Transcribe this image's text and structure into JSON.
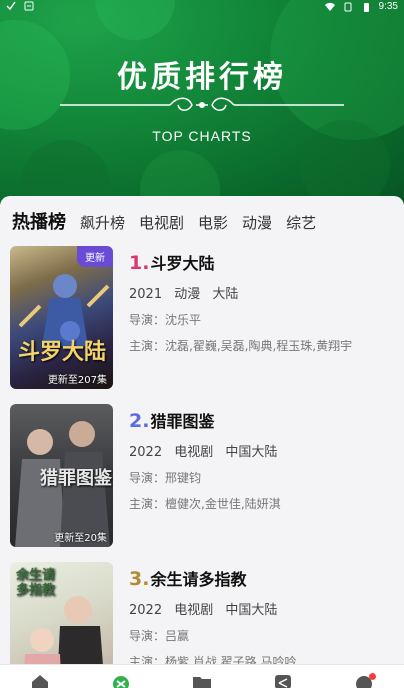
{
  "status": {
    "time": "9:35"
  },
  "banner": {
    "title": "优质排行榜",
    "subtitle": "TOP CHARTS"
  },
  "tabs": [
    {
      "label": "热播榜",
      "active": true
    },
    {
      "label": "飙升榜"
    },
    {
      "label": "电视剧"
    },
    {
      "label": "电影"
    },
    {
      "label": "动漫"
    },
    {
      "label": "综艺"
    }
  ],
  "items": [
    {
      "rank": "1.",
      "rank_color": "#e0336b",
      "title": "斗罗大陆",
      "year": "2021",
      "genre": "动漫",
      "region": "大陆",
      "director": "导演：沈乐平",
      "cast": "主演：沈磊,翟巍,吴磊,陶典,程玉珠,黄翔宇",
      "badge": "更新",
      "update": "更新至207集",
      "art_text": "斗罗大陆"
    },
    {
      "rank": "2.",
      "rank_color": "#5b6ee1",
      "title": "猎罪图鉴",
      "year": "2022",
      "genre": "电视剧",
      "region": "中国大陆",
      "director": "导演：邢键钧",
      "cast": "主演：檀健次,金世佳,陆妍淇",
      "update": "更新至20集",
      "art_text": "猎罪图鉴"
    },
    {
      "rank": "3.",
      "rank_color": "#b8892e",
      "title": "余生请多指教",
      "year": "2022",
      "genre": "电视剧",
      "region": "中国大陆",
      "director": "导演：吕赢",
      "cast": "主演：杨紫,肖战,翟子路,马吟吟",
      "art_text": "余生请多指教"
    }
  ],
  "colors": {
    "primary_green": "#138a3b",
    "badge_purple": "#6a4bd6"
  },
  "nav_icons": [
    "home-icon",
    "logo-icon",
    "folder-icon",
    "share-icon",
    "profile-icon"
  ]
}
